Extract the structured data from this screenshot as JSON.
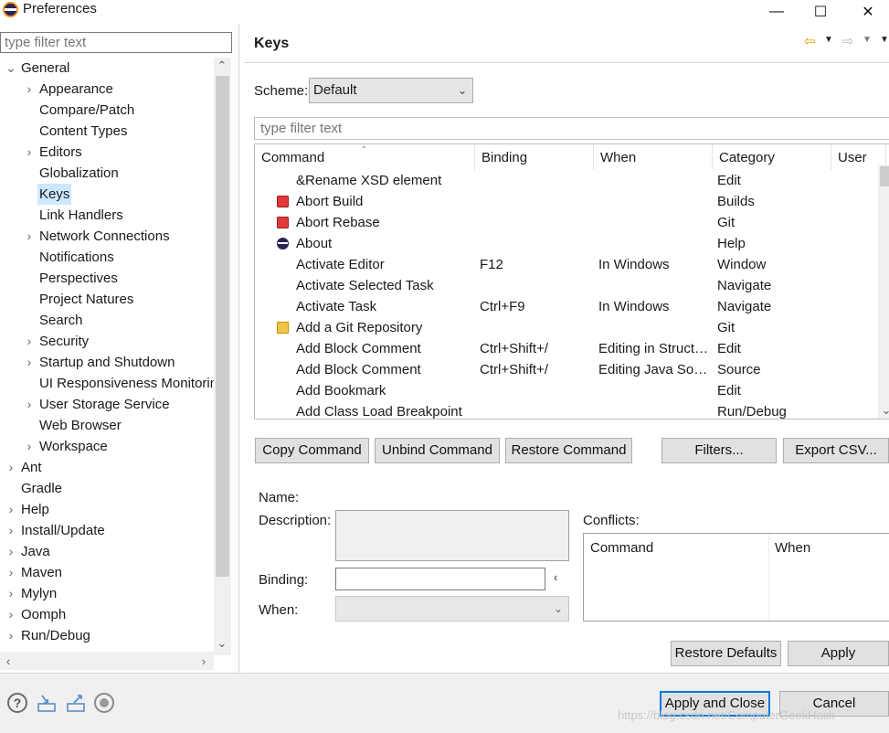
{
  "window": {
    "title": "Preferences",
    "minimize": "—",
    "maximize": "☐",
    "close": "✕"
  },
  "sidebar": {
    "filter_placeholder": "type filter text",
    "tree": [
      {
        "label": "General",
        "level": 0,
        "arrow": "down"
      },
      {
        "label": "Appearance",
        "level": 1,
        "arrow": "right"
      },
      {
        "label": "Compare/Patch",
        "level": 1,
        "arrow": ""
      },
      {
        "label": "Content Types",
        "level": 1,
        "arrow": ""
      },
      {
        "label": "Editors",
        "level": 1,
        "arrow": "right"
      },
      {
        "label": "Globalization",
        "level": 1,
        "arrow": ""
      },
      {
        "label": "Keys",
        "level": 1,
        "arrow": "",
        "selected": true
      },
      {
        "label": "Link Handlers",
        "level": 1,
        "arrow": ""
      },
      {
        "label": "Network Connections",
        "level": 1,
        "arrow": "right"
      },
      {
        "label": "Notifications",
        "level": 1,
        "arrow": ""
      },
      {
        "label": "Perspectives",
        "level": 1,
        "arrow": ""
      },
      {
        "label": "Project Natures",
        "level": 1,
        "arrow": ""
      },
      {
        "label": "Search",
        "level": 1,
        "arrow": ""
      },
      {
        "label": "Security",
        "level": 1,
        "arrow": "right"
      },
      {
        "label": "Startup and Shutdown",
        "level": 1,
        "arrow": "right"
      },
      {
        "label": "UI Responsiveness Monitorin",
        "level": 1,
        "arrow": ""
      },
      {
        "label": "User Storage Service",
        "level": 1,
        "arrow": "right"
      },
      {
        "label": "Web Browser",
        "level": 1,
        "arrow": ""
      },
      {
        "label": "Workspace",
        "level": 1,
        "arrow": "right"
      },
      {
        "label": "Ant",
        "level": 0,
        "arrow": "right"
      },
      {
        "label": "Gradle",
        "level": 0,
        "arrow": ""
      },
      {
        "label": "Help",
        "level": 0,
        "arrow": "right"
      },
      {
        "label": "Install/Update",
        "level": 0,
        "arrow": "right"
      },
      {
        "label": "Java",
        "level": 0,
        "arrow": "right"
      },
      {
        "label": "Maven",
        "level": 0,
        "arrow": "right"
      },
      {
        "label": "Mylyn",
        "level": 0,
        "arrow": "right"
      },
      {
        "label": "Oomph",
        "level": 0,
        "arrow": "right"
      },
      {
        "label": "Run/Debug",
        "level": 0,
        "arrow": "right"
      }
    ]
  },
  "page": {
    "title": "Keys",
    "scheme_label": "Scheme:",
    "scheme_value": "Default",
    "filter_placeholder": "type filter text"
  },
  "table": {
    "columns": [
      "Command",
      "Binding",
      "When",
      "Category",
      "User"
    ],
    "rows": [
      {
        "command": "&Rename XSD element",
        "binding": "",
        "when": "",
        "category": "Edit",
        "icon": ""
      },
      {
        "command": "Abort Build",
        "binding": "",
        "when": "",
        "category": "Builds",
        "icon": "stop"
      },
      {
        "command": "Abort Rebase",
        "binding": "",
        "when": "",
        "category": "Git",
        "icon": "stop"
      },
      {
        "command": "About",
        "binding": "",
        "when": "",
        "category": "Help",
        "icon": "eclipse"
      },
      {
        "command": "Activate Editor",
        "binding": "F12",
        "when": "In Windows",
        "category": "Window",
        "icon": ""
      },
      {
        "command": "Activate Selected Task",
        "binding": "",
        "when": "",
        "category": "Navigate",
        "icon": ""
      },
      {
        "command": "Activate Task",
        "binding": "Ctrl+F9",
        "when": "In Windows",
        "category": "Navigate",
        "icon": ""
      },
      {
        "command": "Add a Git Repository",
        "binding": "",
        "when": "",
        "category": "Git",
        "icon": "git"
      },
      {
        "command": "Add Block Comment",
        "binding": "Ctrl+Shift+/",
        "when": "Editing in Structu...",
        "category": "Edit",
        "icon": ""
      },
      {
        "command": "Add Block Comment",
        "binding": "Ctrl+Shift+/",
        "when": "Editing Java Sour...",
        "category": "Source",
        "icon": ""
      },
      {
        "command": "Add Bookmark",
        "binding": "",
        "when": "",
        "category": "Edit",
        "icon": ""
      },
      {
        "command": "Add Class Load Breakpoint",
        "binding": "",
        "when": "",
        "category": "Run/Debug",
        "icon": ""
      }
    ]
  },
  "buttons": {
    "copy": "Copy Command",
    "unbind": "Unbind Command",
    "restore": "Restore Command",
    "filters": "Filters...",
    "export": "Export CSV...",
    "restore_defaults": "Restore Defaults",
    "apply": "Apply",
    "apply_close": "Apply and Close",
    "cancel": "Cancel"
  },
  "details": {
    "name_label": "Name:",
    "description_label": "Description:",
    "binding_label": "Binding:",
    "when_label": "When:",
    "conflicts_label": "Conflicts:",
    "conflicts_columns": [
      "Command",
      "When"
    ]
  },
  "watermark": "https://blog.csdn.net/ComputerGeekHack",
  "colors": {
    "selection": "#cce8ff",
    "default_button_border": "#0078d7"
  }
}
